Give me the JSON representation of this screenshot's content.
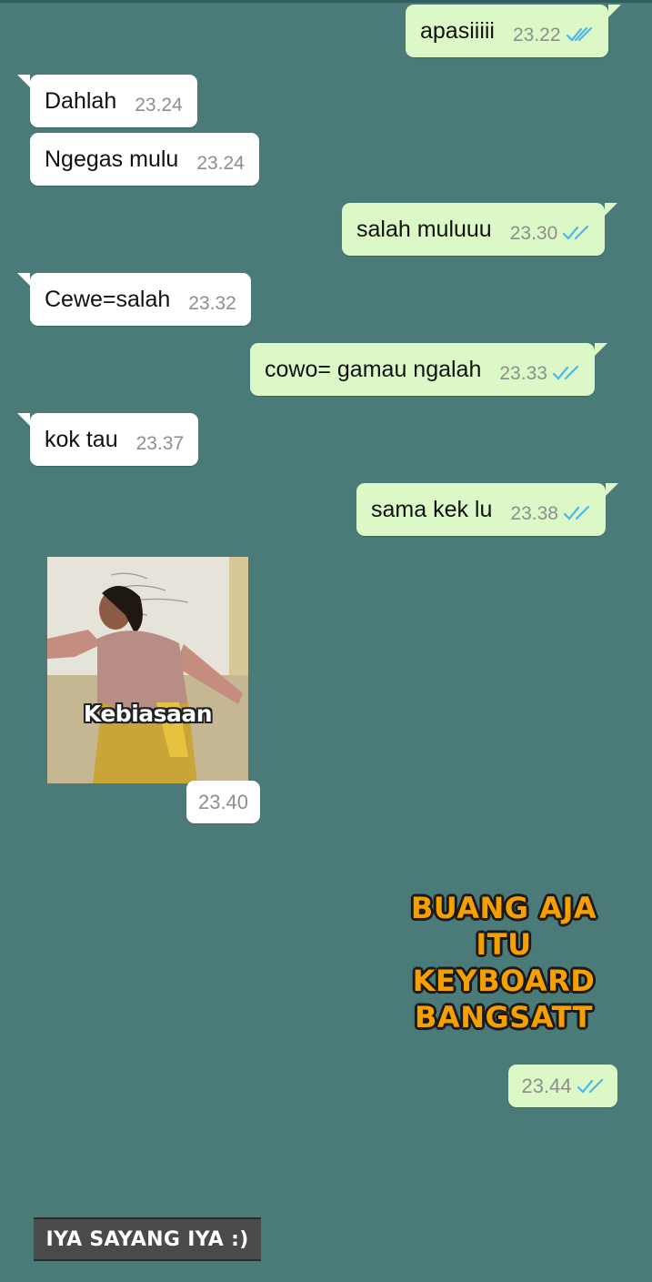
{
  "colors": {
    "chat_background": "#4a7b78",
    "incoming_bubble": "#ffffff",
    "outgoing_bubble": "#dcf8c6",
    "read_ticks": "#4fb6ec",
    "timestamp": "#8e8e8e",
    "sticker_text": "#f5a000"
  },
  "messages": [
    {
      "direction": "outgoing",
      "text": "apasiiiii",
      "time": "23.22",
      "status_icon": "double-check-read-icon"
    },
    {
      "direction": "incoming",
      "text": "Dahlah",
      "time": "23.24"
    },
    {
      "direction": "incoming",
      "text": "Ngegas mulu",
      "time": "23.24"
    },
    {
      "direction": "outgoing",
      "text": "salah muluuu",
      "time": "23.30",
      "status_icon": "double-check-read-icon"
    },
    {
      "direction": "incoming",
      "text": "Cewe=salah",
      "time": "23.32"
    },
    {
      "direction": "outgoing",
      "text": "cowo= gamau ngalah",
      "time": "23.33",
      "status_icon": "double-check-read-icon"
    },
    {
      "direction": "incoming",
      "text": "kok tau",
      "time": "23.37"
    },
    {
      "direction": "outgoing",
      "text": "sama kek lu",
      "time": "23.38",
      "status_icon": "double-check-read-icon"
    }
  ],
  "incoming_sticker": {
    "caption": "Kebiasaan",
    "time": "23.40"
  },
  "outgoing_sticker": {
    "lines": [
      "BUANG AJA",
      "ITU",
      "KEYBOARD",
      "BANGSATT"
    ],
    "time": "23.44",
    "status_icon": "double-check-read-icon"
  },
  "bottom_banner": {
    "text": "IYA SAYANG IYA :)"
  }
}
